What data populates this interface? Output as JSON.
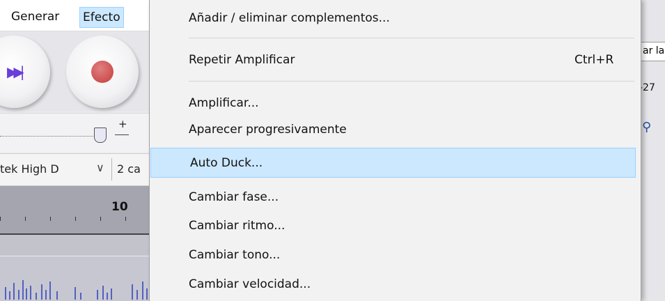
{
  "menubar": {
    "items": [
      "Generar",
      "Efecto"
    ]
  },
  "device": {
    "name": "tek High D",
    "channels": "2 ca",
    "chevron_icon": "chevron-down-icon"
  },
  "ruler": {
    "label": "10"
  },
  "right_edge": {
    "box_text": "ar la",
    "number": "-27"
  },
  "menu": {
    "add_remove": "Añadir / eliminar complementos...",
    "repeat": {
      "label": "Repetir Amplificar",
      "shortcut": "Ctrl+R"
    },
    "items": [
      "Amplificar...",
      "Aparecer progresivamente",
      "Auto Duck...",
      "Cambiar fase...",
      "Cambiar ritmo...",
      "Cambiar tono...",
      "Cambiar velocidad..."
    ],
    "highlighted_index": 2
  },
  "colors": {
    "highlight_bg": "#cce8ff",
    "highlight_border": "#99d1ff",
    "record": "#c73b3b",
    "skip": "#6a3fd8"
  }
}
